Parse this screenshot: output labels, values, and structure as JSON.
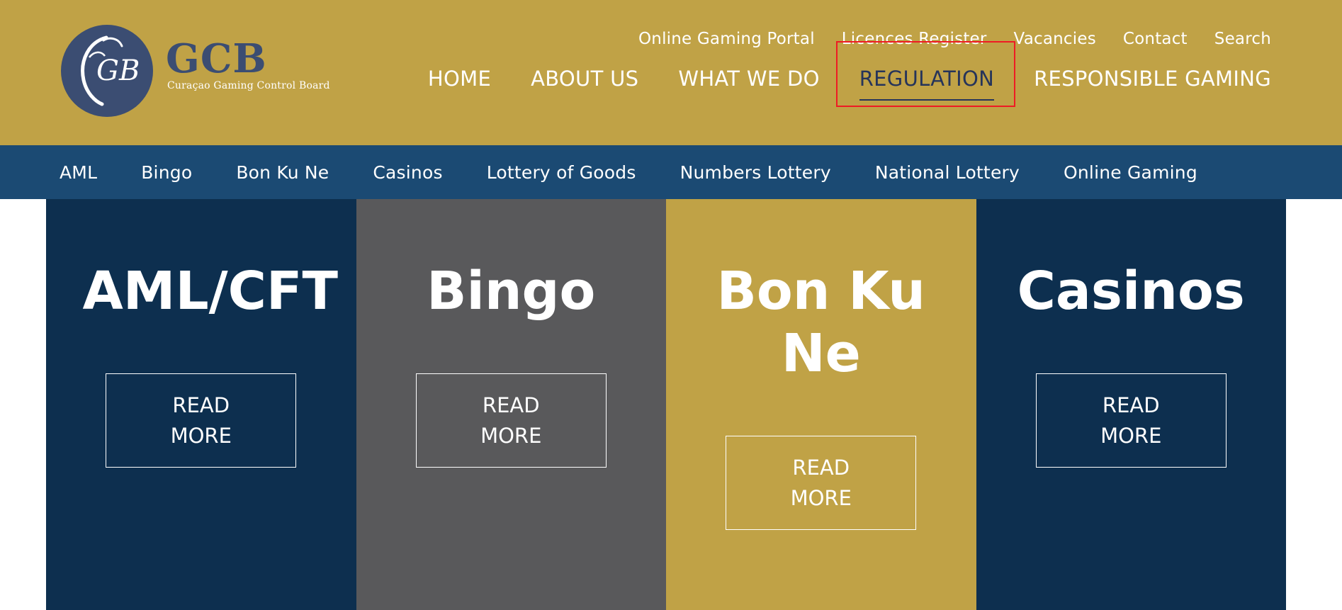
{
  "colors": {
    "header_bg": "#c0a246",
    "subnav_bg": "#1b4a73",
    "brand_navy": "#3b4d72",
    "active_link": "#26345a",
    "highlight_border": "#ee1b24",
    "tile_navy": "#0d2f4f",
    "tile_gray": "#59595b",
    "tile_gold": "#c0a246"
  },
  "logo": {
    "monogram": "GB",
    "abbr": "GCB",
    "full_name": "Curaçao Gaming Control Board"
  },
  "util_nav": [
    {
      "label": "Online Gaming Portal",
      "name": "util-link-online-gaming-portal"
    },
    {
      "label": "Licences Register",
      "name": "util-link-licences-register"
    },
    {
      "label": "Vacancies",
      "name": "util-link-vacancies"
    },
    {
      "label": "Contact",
      "name": "util-link-contact"
    },
    {
      "label": "Search",
      "name": "util-link-search"
    }
  ],
  "main_nav": [
    {
      "label": "HOME",
      "name": "nav-home",
      "active": false
    },
    {
      "label": "ABOUT US",
      "name": "nav-about-us",
      "active": false
    },
    {
      "label": "WHAT WE DO",
      "name": "nav-what-we-do",
      "active": false
    },
    {
      "label": "REGULATION",
      "name": "nav-regulation",
      "active": true
    },
    {
      "label": "RESPONSIBLE GAMING",
      "name": "nav-responsible-gaming",
      "active": false
    }
  ],
  "sub_nav": [
    {
      "label": "AML",
      "name": "subnav-aml"
    },
    {
      "label": "Bingo",
      "name": "subnav-bingo"
    },
    {
      "label": "Bon Ku Ne",
      "name": "subnav-bon-ku-ne"
    },
    {
      "label": "Casinos",
      "name": "subnav-casinos"
    },
    {
      "label": "Lottery of Goods",
      "name": "subnav-lottery-of-goods"
    },
    {
      "label": "Numbers Lottery",
      "name": "subnav-numbers-lottery"
    },
    {
      "label": "National Lottery",
      "name": "subnav-national-lottery"
    },
    {
      "label": "Online Gaming",
      "name": "subnav-online-gaming"
    }
  ],
  "tiles": [
    {
      "title": "AML/CFT",
      "button": "READ MORE",
      "color": "#0d2f4f",
      "name": "aml-cft"
    },
    {
      "title": "Bingo",
      "button": "READ MORE",
      "color": "#59595b",
      "name": "bingo"
    },
    {
      "title": "Bon Ku Ne",
      "button": "READ MORE",
      "color": "#c0a246",
      "name": "bon-ku-ne"
    },
    {
      "title": "Casinos",
      "button": "READ MORE",
      "color": "#0d2f4f",
      "name": "casinos"
    }
  ]
}
